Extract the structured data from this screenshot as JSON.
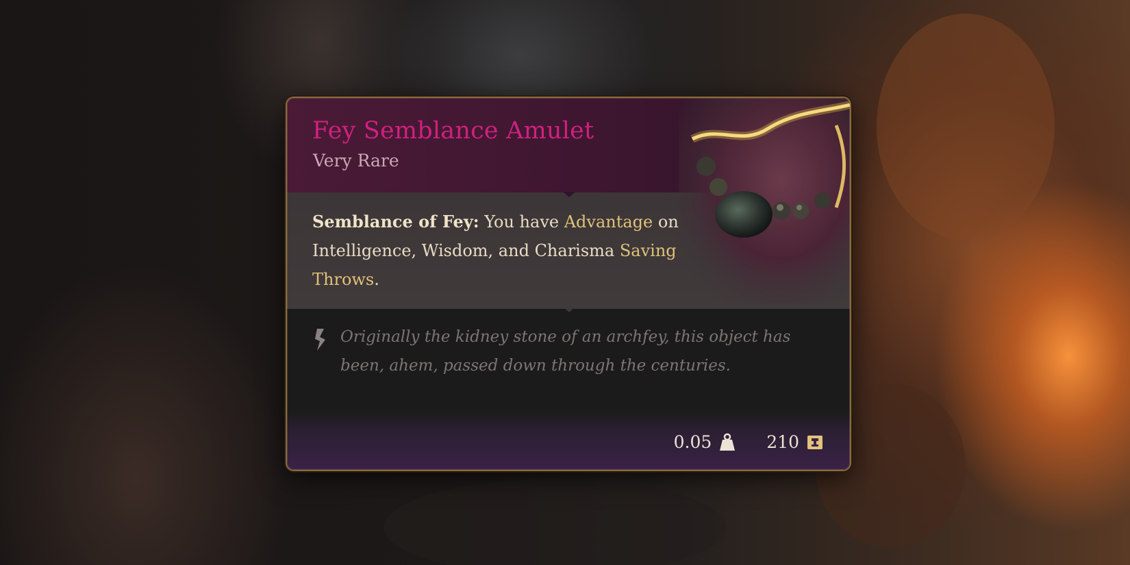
{
  "item": {
    "name": "Fey Semblance Amulet",
    "rarity": "Very Rare",
    "image_icon": "amulet-artwork",
    "effect": {
      "name": "Semblance of Fey:",
      "text_1": " You have ",
      "keyword_1": "Advantage",
      "text_2": " on Intelligence, Wisdom, and Charisma ",
      "keyword_2": "Saving Throws",
      "text_3": "."
    },
    "flavor": {
      "icon": "quote-icon",
      "text": "Originally the kidney stone of an archfey, this object has been, ahem, passed down through the centuries."
    },
    "stats": {
      "weight": "0.05",
      "weight_icon": "weight-icon",
      "value": "210",
      "value_icon": "gold-coin-icon"
    }
  },
  "colors": {
    "title": "#d0207f",
    "rarity": "#c9a9b6",
    "keyword": "#e0c27a",
    "flavor": "#7d7572",
    "border": "#8a6a3c"
  }
}
